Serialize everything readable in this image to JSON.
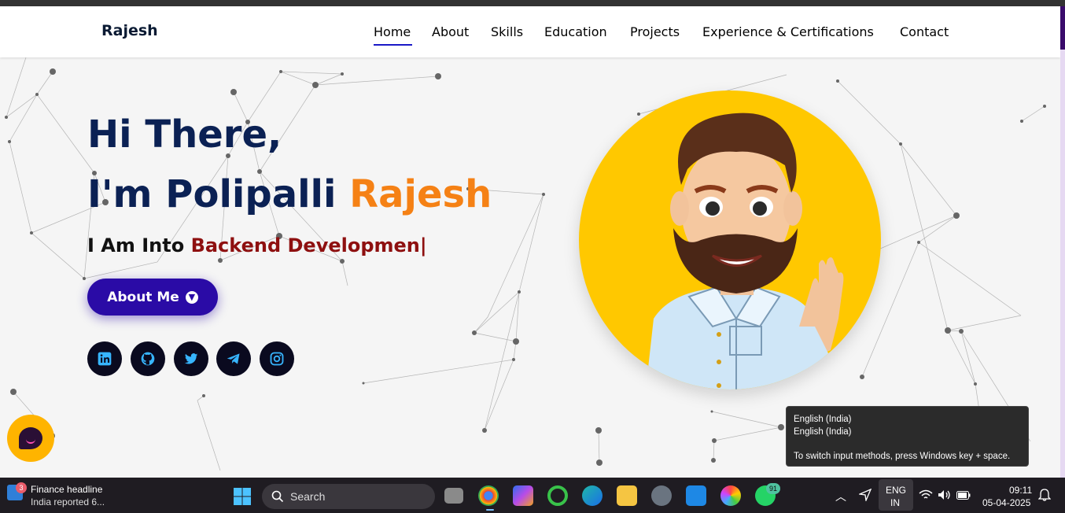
{
  "brand": "Rajesh",
  "nav": {
    "items": [
      {
        "label": "Home",
        "active": true
      },
      {
        "label": "About"
      },
      {
        "label": "Skills"
      },
      {
        "label": "Education"
      },
      {
        "label": "Projects"
      },
      {
        "label": "Experience & Certifications"
      },
      {
        "label": "Contact"
      }
    ]
  },
  "hero": {
    "greeting": "Hi There,",
    "intro": "I'm Polipalli ",
    "name": "Rajesh",
    "tagline_prefix": "I Am Into ",
    "tagline_typed": "Backend Developmen|",
    "about_button": "About Me",
    "accent": "#f58115",
    "button_color": "#2a0ba6"
  },
  "social": [
    {
      "icon": "linkedin-icon"
    },
    {
      "icon": "github-icon"
    },
    {
      "icon": "twitter-icon"
    },
    {
      "icon": "telegram-icon"
    },
    {
      "icon": "instagram-icon"
    }
  ],
  "tooltip": {
    "line1": "English (India)",
    "line2": "English (India)",
    "hint": "To switch input methods, press Windows key + space."
  },
  "taskbar": {
    "news_badge": "3",
    "news_title": "Finance headline",
    "news_sub": "India reported 6...",
    "search_placeholder": "Search",
    "whatsapp_badge": "91",
    "lang_line1": "ENG",
    "lang_line2": "IN",
    "time": "09:11",
    "date": "05-04-2025"
  }
}
